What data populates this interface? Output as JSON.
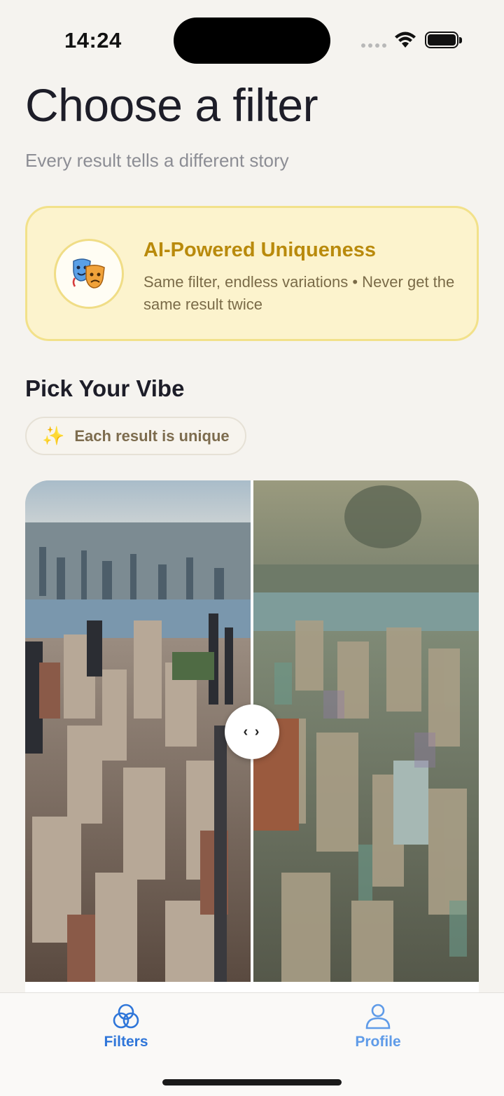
{
  "status_bar": {
    "time": "14:24"
  },
  "header": {
    "title": "Choose a filter",
    "subtitle": "Every result tells a different story"
  },
  "ai_card": {
    "icon": "theater-masks-icon",
    "title": "AI-Powered Uniqueness",
    "description": "Same filter, endless variations • Never get the same result twice"
  },
  "section": {
    "title": "Pick Your Vibe",
    "chip_icon": "✨",
    "chip_label": "Each result is unique"
  },
  "compare": {
    "handle_glyph": "‹ ›",
    "split": 0.5
  },
  "tabbar": {
    "items": [
      {
        "label": "Filters",
        "icon": "filters-circles-icon",
        "selected": true
      },
      {
        "label": "Profile",
        "icon": "person-icon",
        "selected": false
      }
    ]
  },
  "colors": {
    "background": "#f5f3ef",
    "card_bg": "#fcf3cd",
    "card_border": "#f2e18a",
    "card_title": "#b98a0c",
    "tab_active": "#2f76d9"
  }
}
